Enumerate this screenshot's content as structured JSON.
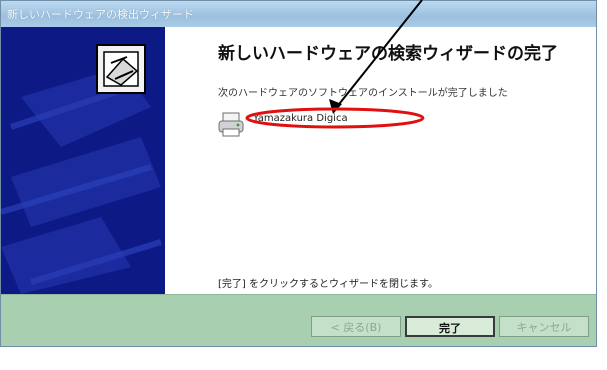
{
  "window": {
    "title": "新しいハードウェアの検出ウィザード"
  },
  "content": {
    "heading": "新しいハードウェアの検索ウィザードの完了",
    "message": "次のハードウェアのソフトウェアのインストールが完了しました",
    "device_name": "Yamazakura Digica",
    "finish_note": "[完了] をクリックするとウィザードを閉じます。"
  },
  "buttons": {
    "back_label": "< 戻る(B)",
    "finish_label": "完了",
    "cancel_label": "キャンセル"
  },
  "icons": {
    "wizard": "installer-box-icon",
    "device": "printer-icon"
  },
  "colors": {
    "sidebar": "#0d1a86",
    "footer": "#a8cfb0",
    "highlight": "#e01010"
  }
}
